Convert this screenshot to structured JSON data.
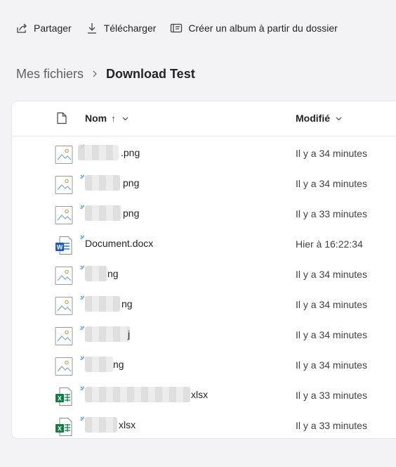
{
  "toolbar": {
    "share_label": "Partager",
    "download_label": "Télécharger",
    "album_label": "Créer un album à partir du dossier"
  },
  "breadcrumb": {
    "parent": "Mes fichiers",
    "current": "Download Test"
  },
  "columns": {
    "name": "Nom",
    "sort_arrow": "↑",
    "modified": "Modifié"
  },
  "files": [
    {
      "name_visible": ".png",
      "type": "image",
      "modified": "Il y a 34 minutes"
    },
    {
      "name_visible": "png",
      "type": "image",
      "modified": "Il y a 34 minutes"
    },
    {
      "name_visible": "png",
      "type": "image",
      "modified": "Il y a 33 minutes"
    },
    {
      "name_visible": "Document.docx",
      "type": "word",
      "modified": "Hier à 16:22:34"
    },
    {
      "name_visible": "ng",
      "type": "image",
      "modified": "Il y a 34 minutes"
    },
    {
      "name_visible": "ng",
      "type": "image",
      "modified": "Il y a 34 minutes"
    },
    {
      "name_visible": "j",
      "type": "image",
      "modified": "Il y a 34 minutes"
    },
    {
      "name_visible": "ng",
      "type": "image",
      "modified": "Il y a 34 minutes"
    },
    {
      "name_visible": "xlsx",
      "type": "excel",
      "modified": "Il y a 33 minutes"
    },
    {
      "name_visible": "xlsx",
      "type": "excel",
      "modified": "Il y a 33 minutes"
    }
  ]
}
